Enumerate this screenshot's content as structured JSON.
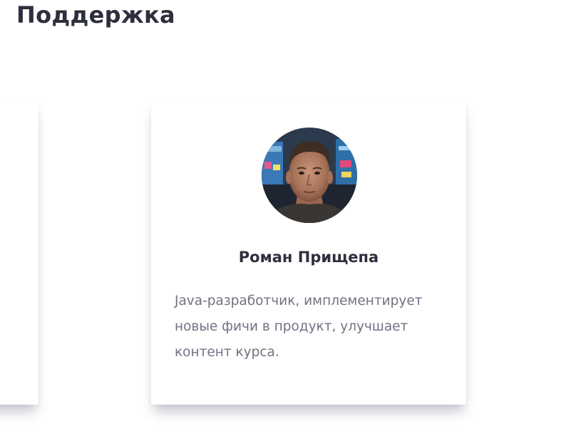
{
  "section": {
    "title": "Поддержка"
  },
  "team": [
    {
      "name": "Роман Прищепа",
      "description": "Java-разработчик, имплементирует новые фичи в продукт, улучшает контент курса.",
      "avatar": "person-photo"
    }
  ],
  "colors": {
    "title": "#2e2f3e",
    "text": "#707382",
    "card_bg": "#ffffff"
  }
}
